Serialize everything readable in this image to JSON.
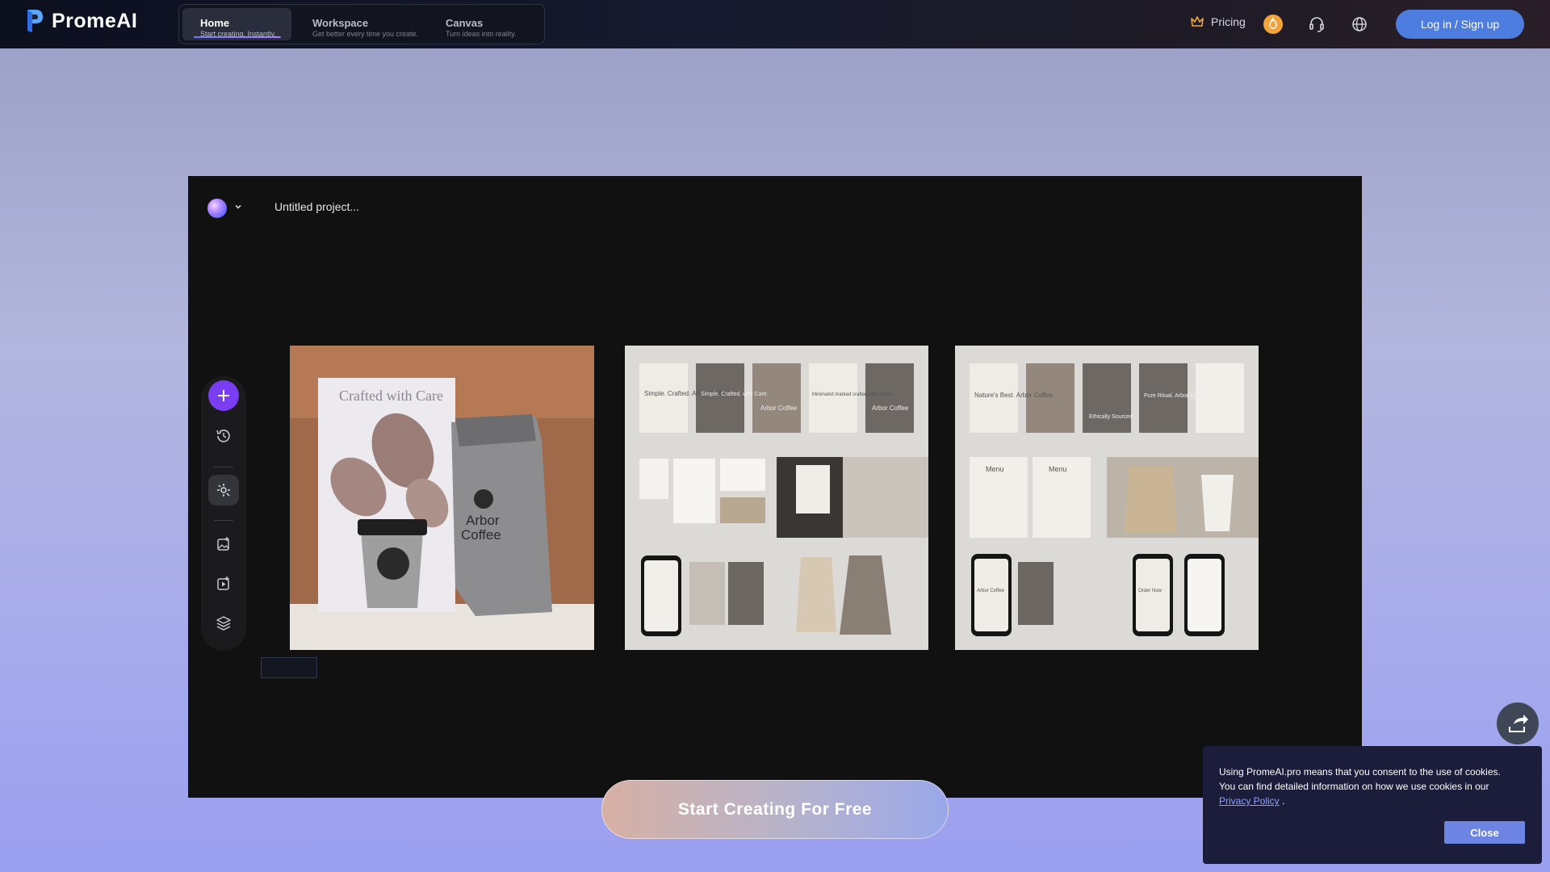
{
  "brand": {
    "name": "PromeAI"
  },
  "nav": {
    "tabs": [
      {
        "label": "Home",
        "sub": "Start creating. Instantly."
      },
      {
        "label": "Workspace",
        "sub": "Get better every time you create."
      },
      {
        "label": "Canvas",
        "sub": "Turn ideas into reality."
      }
    ],
    "pricing": "Pricing",
    "login": "Log in / Sign up",
    "icons": [
      "crown-icon",
      "flame-icon",
      "headset-icon",
      "globe-icon"
    ]
  },
  "project": {
    "title": "Untitled project..."
  },
  "toolbar": {
    "tools": [
      "add-icon",
      "history-icon",
      "magic-icon",
      "image-edit-icon",
      "video-icon",
      "layers-icon"
    ]
  },
  "thumbs": {
    "first": {
      "poster_text": "Crafted with Care",
      "bag_text_line1": "Arbor",
      "bag_text_line2": "Coffee"
    },
    "second": {
      "cards": [
        "Simple. Crafted. Arbor Coffee.",
        "Simple. Crafted. with Care.",
        "Arbor Coffee",
        "Minimalist marked crafted with coffee.",
        "Arbor Coffee"
      ]
    },
    "third": {
      "cards": [
        "Nature's Best. Arbor Coffee.",
        "",
        "Ethically Sourced.",
        "Pure Ritual. Arbor Coffee.",
        ""
      ],
      "menu1": "Menu",
      "menu2": "Menu",
      "phone1": "Arbor Coffee",
      "phone2": "Order Now"
    }
  },
  "cta": {
    "label": "Start Creating For Free"
  },
  "cookie": {
    "text": "Using PromeAI.pro means that you consent to the use of cookies. You can find detailed information on how we use cookies in our",
    "link": "Privacy Policy",
    "after": " .",
    "close": "Close"
  },
  "colors": {
    "accent": "#7a3df2",
    "login": "#4e7de0",
    "cookie_bg": "#1b1d3b",
    "cookie_btn": "#6e84e3"
  }
}
